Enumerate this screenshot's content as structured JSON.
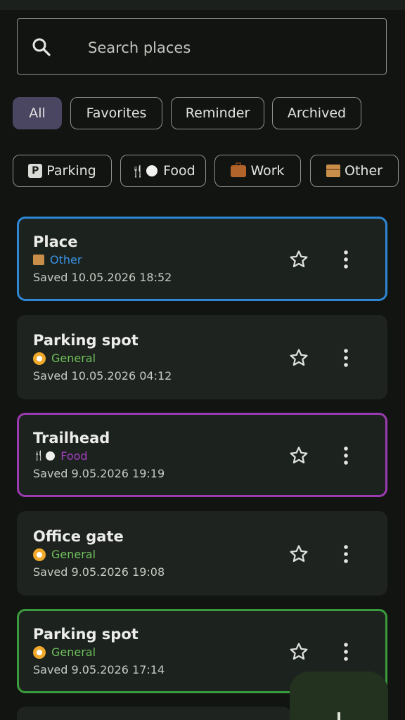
{
  "search": {
    "placeholder": "Search places"
  },
  "filters": [
    {
      "label": "All",
      "selected": true
    },
    {
      "label": "Favorites",
      "selected": false
    },
    {
      "label": "Reminder",
      "selected": false
    },
    {
      "label": "Archived",
      "selected": false
    }
  ],
  "categories": [
    {
      "label": "Parking",
      "icon": "parking-icon"
    },
    {
      "label": "Food",
      "icon": "food-icon"
    },
    {
      "label": "Work",
      "icon": "briefcase-icon"
    },
    {
      "label": "Other",
      "icon": "package-icon"
    }
  ],
  "places": [
    {
      "title": "Place",
      "category": "Other",
      "category_color": "#3b93e6",
      "category_icon": "package-icon",
      "saved": "Saved 10.05.2026 18:52",
      "border_color": "#2f86d6"
    },
    {
      "title": "Parking spot",
      "category": "General",
      "category_color": "#6fbf5a",
      "category_icon": "compass-icon",
      "saved": "Saved 10.05.2026 04:12",
      "border_color": null
    },
    {
      "title": "Trailhead",
      "category": "Food",
      "category_color": "#a63fc4",
      "category_icon": "food-icon",
      "saved": "Saved 9.05.2026 19:19",
      "border_color": "#9a3bb0"
    },
    {
      "title": "Office gate",
      "category": "General",
      "category_color": "#6fbf5a",
      "category_icon": "compass-icon",
      "saved": "Saved 9.05.2026 19:08",
      "border_color": null
    },
    {
      "title": "Parking spot",
      "category": "General",
      "category_color": "#6fbf5a",
      "category_icon": "compass-icon",
      "saved": "Saved 9.05.2026 17:14",
      "border_color": "#3a9b3d"
    }
  ],
  "fab": {
    "icon": "plus-icon"
  }
}
